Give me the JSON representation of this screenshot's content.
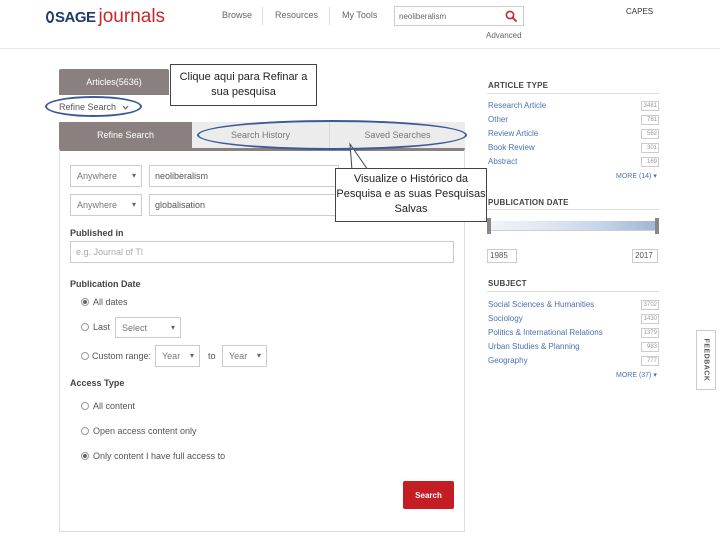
{
  "header": {
    "logo_sage": "SAGE",
    "logo_journals": "journals",
    "nav": [
      "Browse",
      "Resources",
      "My Tools"
    ],
    "search_value": "neoliberalism",
    "advanced": "Advanced",
    "institution": "CAPES"
  },
  "left": {
    "articles_tab": "Articles(5636)",
    "refine_label": "Refine Search",
    "tabs": [
      "Refine Search",
      "Search History",
      "Saved Searches"
    ],
    "active_tab": 0,
    "rows": [
      {
        "field": "Anywhere",
        "term": "neoliberalism"
      },
      {
        "field": "Anywhere",
        "term": "globalisation"
      }
    ],
    "published_in": {
      "title": "Published in",
      "placeholder": "e.g. Journal of Tl"
    },
    "publication_date": {
      "title": "Publication Date",
      "all_dates": "All dates",
      "last": "Last",
      "last_select": "Select",
      "custom_range": "Custom range:",
      "year_from": "Year",
      "to": "to",
      "year_to": "Year",
      "selected": "all_dates"
    },
    "access_type": {
      "title": "Access Type",
      "options": [
        "All content",
        "Open access content only",
        "Only content I have full access to"
      ],
      "selected": 2
    },
    "search_button": "Search"
  },
  "sidebar": {
    "article_type": {
      "title": "ARTICLE TYPE",
      "items": [
        {
          "label": "Research Article",
          "count": "3481"
        },
        {
          "label": "Other",
          "count": "781"
        },
        {
          "label": "Review Article",
          "count": "562"
        },
        {
          "label": "Book Review",
          "count": "301"
        },
        {
          "label": "Abstract",
          "count": "169"
        }
      ],
      "more": "MORE (14)"
    },
    "publication_date": {
      "title": "PUBLICATION DATE",
      "from": "1985",
      "to": "2017"
    },
    "subject": {
      "title": "SUBJECT",
      "items": [
        {
          "label": "Social Sciences & Humanities",
          "count": "3702"
        },
        {
          "label": "Sociology",
          "count": "1430"
        },
        {
          "label": "Politics & International Relations",
          "count": "1379"
        },
        {
          "label": "Urban Studies & Planning",
          "count": "983"
        },
        {
          "label": "Geography",
          "count": "777"
        }
      ],
      "more": "MORE (37)"
    }
  },
  "feedback": "FEEDBACK",
  "callouts": {
    "refine": "Clique aqui para Refinar a sua pesquisa",
    "history": "Visualize o Histórico da Pesquisa e as suas Pesquisas Salvas"
  },
  "colors": {
    "brand_blue": "#1e3a6e",
    "brand_red": "#c62828",
    "tab_active": "#8a8080",
    "link": "#4a72b0",
    "search_button": "#c41e24",
    "oval": "#3b5998"
  }
}
